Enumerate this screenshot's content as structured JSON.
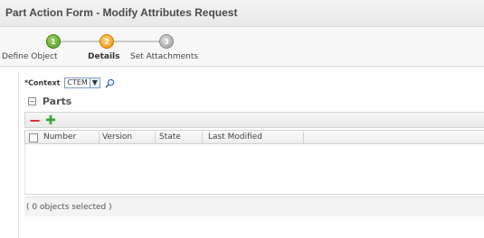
{
  "window": {
    "title": "Part Action Form - Modify Attributes Request"
  },
  "wizard": {
    "steps": [
      {
        "number": "1",
        "label": "Define Object",
        "state": "done"
      },
      {
        "number": "2",
        "label": "Details",
        "state": "active"
      },
      {
        "number": "3",
        "label": "Set Attachments",
        "state": "todo"
      }
    ]
  },
  "context": {
    "label": "*Context",
    "value": "CTEM",
    "dropdown_glyph": "▼"
  },
  "parts": {
    "collapse_glyph": "⊟",
    "title": "Parts",
    "toolbar": {
      "remove_glyph": "−",
      "add_glyph": "✚"
    },
    "columns": [
      "Number",
      "Version",
      "State",
      "Last Modified"
    ],
    "rows": [],
    "status": "( 0 objects selected )"
  },
  "colors": {
    "step_done": "#4e9a1e",
    "step_active": "#f08c00",
    "step_todo": "#9a9a9a",
    "remove": "#e0202a",
    "add": "#3aa635"
  },
  "icons": [
    "search-icon",
    "collapse-icon",
    "remove-icon",
    "add-icon"
  ]
}
